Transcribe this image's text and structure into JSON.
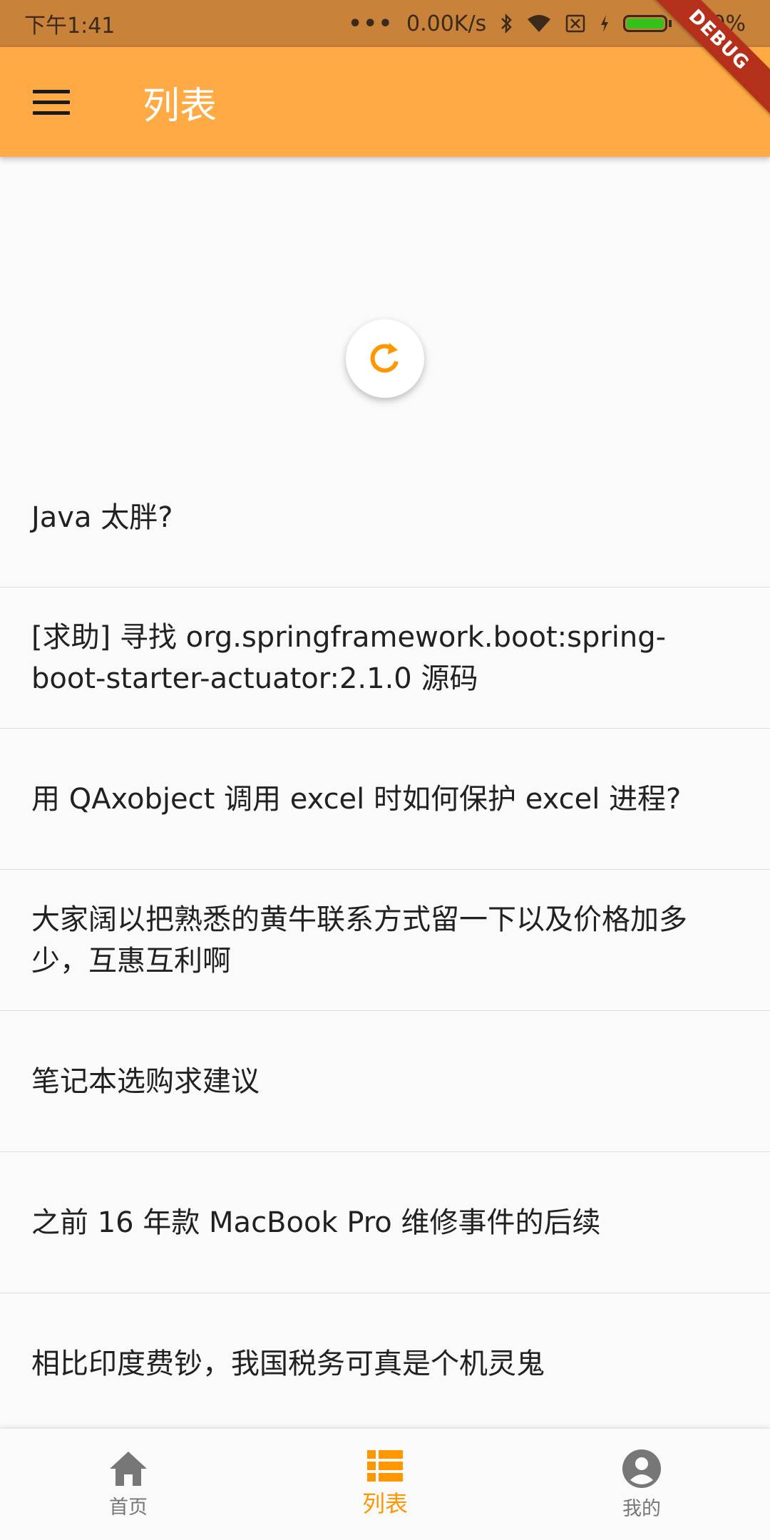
{
  "status_bar": {
    "time": "下午1:41",
    "network_speed": "0.00K/s",
    "battery_percent": "100%",
    "battery_level": 1.0,
    "icons": [
      "more-dots-icon",
      "bluetooth-icon",
      "wifi-icon",
      "sim-off-icon",
      "charging-icon",
      "battery-icon"
    ]
  },
  "debug_banner": "DEBUG",
  "app_bar": {
    "title": "列表",
    "menu_icon": "hamburger-menu-icon"
  },
  "refresh_indicator": {
    "icon": "refresh-icon"
  },
  "list": {
    "items": [
      "Java 太胖?",
      "[求助] 寻找 org.springframework.boot:spring-boot-starter-actuator:2.1.0 源码",
      "用 QAxobject 调用 excel 时如何保护 excel 进程?",
      "大家阔以把熟悉的黄牛联系方式留一下以及价格加多少，互惠互利啊",
      "笔记本选购求建议",
      "之前 16 年款 MacBook Pro 维修事件的后续",
      "相比印度费钞，我国税务可真是个机灵鬼"
    ]
  },
  "bottom_nav": {
    "items": [
      {
        "label": "首页",
        "icon": "home-icon",
        "active": false
      },
      {
        "label": "列表",
        "icon": "list-icon",
        "active": true
      },
      {
        "label": "我的",
        "icon": "account-icon",
        "active": false
      }
    ]
  },
  "colors": {
    "status_bar": "#c8823a",
    "app_bar": "#ffaa44",
    "accent": "#ff9800",
    "debug_ribbon": "#b5301a",
    "battery_fill": "#33c21a"
  }
}
